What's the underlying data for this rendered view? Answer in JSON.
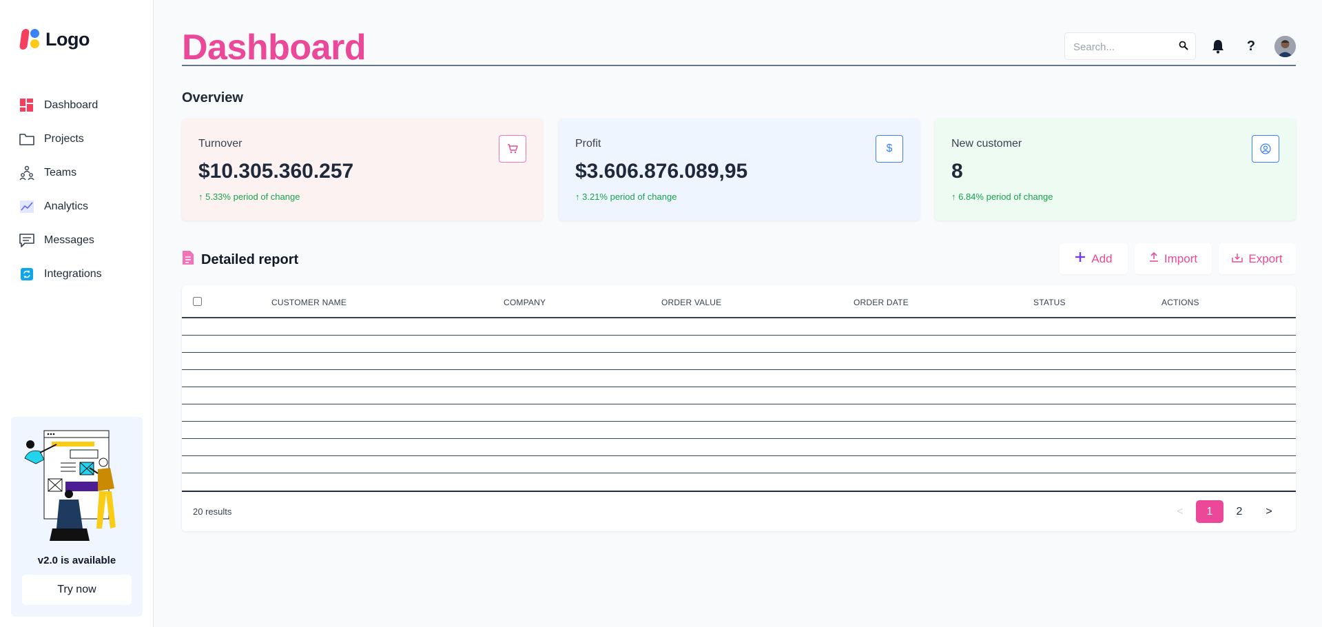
{
  "brand": {
    "logo_text": "Logo",
    "colors": {
      "accent": "#ec4899",
      "positive": "#16a34a"
    }
  },
  "sidebar": {
    "items": [
      {
        "label": "Dashboard",
        "icon": "dashboard-icon"
      },
      {
        "label": "Projects",
        "icon": "folder-icon"
      },
      {
        "label": "Teams",
        "icon": "teams-icon"
      },
      {
        "label": "Analytics",
        "icon": "analytics-icon"
      },
      {
        "label": "Messages",
        "icon": "messages-icon"
      },
      {
        "label": "Integrations",
        "icon": "integrations-icon"
      }
    ],
    "promo": {
      "title": "v2.0 is available",
      "button": "Try now"
    }
  },
  "header": {
    "title": "Dashboard",
    "search_placeholder": "Search...",
    "icons": [
      "search-icon",
      "bell-icon",
      "help-icon",
      "avatar"
    ]
  },
  "overview": {
    "title": "Overview",
    "cards": [
      {
        "label": "Turnover",
        "value": "$10.305.360.257",
        "change": "↑ 5.33% period of change",
        "icon": "cart-icon",
        "bg": "#fdf2f2",
        "icon_color": "#f472b6"
      },
      {
        "label": "Profit",
        "value": "$3.606.876.089,95",
        "change": "↑ 3.21% period of change",
        "icon": "dollar-icon",
        "bg": "#eef5ff",
        "icon_color": "#3b82f6"
      },
      {
        "label": "New customer",
        "value": "8",
        "change": "↑ 6.84% period of change",
        "icon": "user-circle-icon",
        "bg": "#edfbf2",
        "icon_color": "#3b82f6"
      }
    ]
  },
  "report": {
    "title": "Detailed report",
    "actions": {
      "add": "Add",
      "import": "Import",
      "export": "Export"
    },
    "columns": [
      "CUSTOMER NAME",
      "COMPANY",
      "ORDER VALUE",
      "ORDER DATE",
      "STATUS",
      "ACTIONS"
    ],
    "rows": [],
    "results": "20 results",
    "pagination": {
      "prev": "<",
      "pages": [
        "1",
        "2"
      ],
      "current": "1",
      "next": ">"
    }
  }
}
